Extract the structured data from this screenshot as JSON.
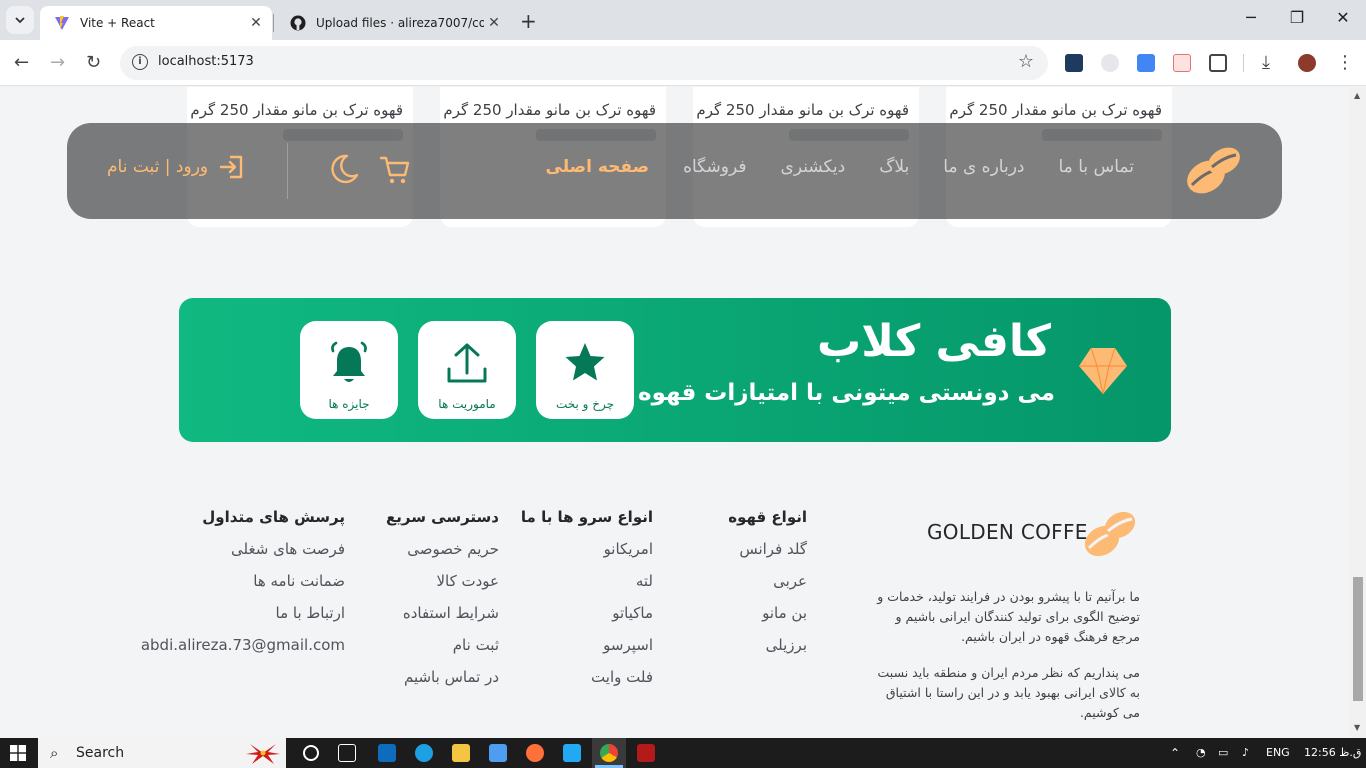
{
  "browser": {
    "tabs": [
      {
        "title": "Vite + React",
        "active": true
      },
      {
        "title": "Upload files · alireza7007/coffee",
        "active": false
      }
    ],
    "url": "localhost:5173"
  },
  "products": {
    "card_name": "قهوه ترک بن مانو مقدار 250 گرم"
  },
  "navbar": {
    "items": [
      "صفحه اصلی",
      "فروشگاه",
      "دیکشنری",
      "بلاگ",
      "درباره ی ما",
      "تماس با ما"
    ],
    "login_label": "ورود | ثبت نام"
  },
  "club": {
    "title": "کافی کلاب",
    "subtitle": "می دونستی میتونی با امتیازات قهوه بگیری؟!",
    "boxes": [
      "چرخ و بخت",
      "ماموریت ها",
      "جایزه ها"
    ]
  },
  "footer": {
    "brand": "GOLDEN COFFE",
    "about_1": "ما برآنیم تا با پیشرو بودن در فرایند تولید، خدمات و توضیح الگوی برای تولید کنندگان ایرانی باشیم و مرجع فرهنگ قهوه در ایران باشیم.",
    "about_2": "می پنداریم که نظر مردم ایران و منطقه باید نسبت به کالای ایرانی بهبود یابد و در این راستا با اشتیاق می کوشیم.",
    "col_coffee": {
      "title": "انواع قهوه",
      "items": [
        "گلد فرانس",
        "عربی",
        "بن مانو",
        "برزیلی"
      ]
    },
    "col_serve": {
      "title": "انواع سرو ها با ما",
      "items": [
        "امریکانو",
        "لته",
        "ماکیاتو",
        "اسپرسو",
        "فلت وایت"
      ]
    },
    "col_quick": {
      "title": "دسترسی سریع",
      "items": [
        "حریم خصوصی",
        "عودت کالا",
        "شرایط استفاده",
        "ثبت نام",
        "در تماس باشیم"
      ]
    },
    "col_faq": {
      "title": "پرسش های متداول",
      "items": [
        "فرصت های شغلی",
        "ضمانت نامه ها",
        "ارتباط با ما",
        "abdi.alireza.73@gmail.com"
      ]
    }
  },
  "taskbar": {
    "search": "Search",
    "lang": "ENG",
    "time": "12:56 ق.ظ"
  },
  "colors": {
    "accent": "#fdba74",
    "club_green": "#10b981",
    "club_dark": "#047857"
  }
}
